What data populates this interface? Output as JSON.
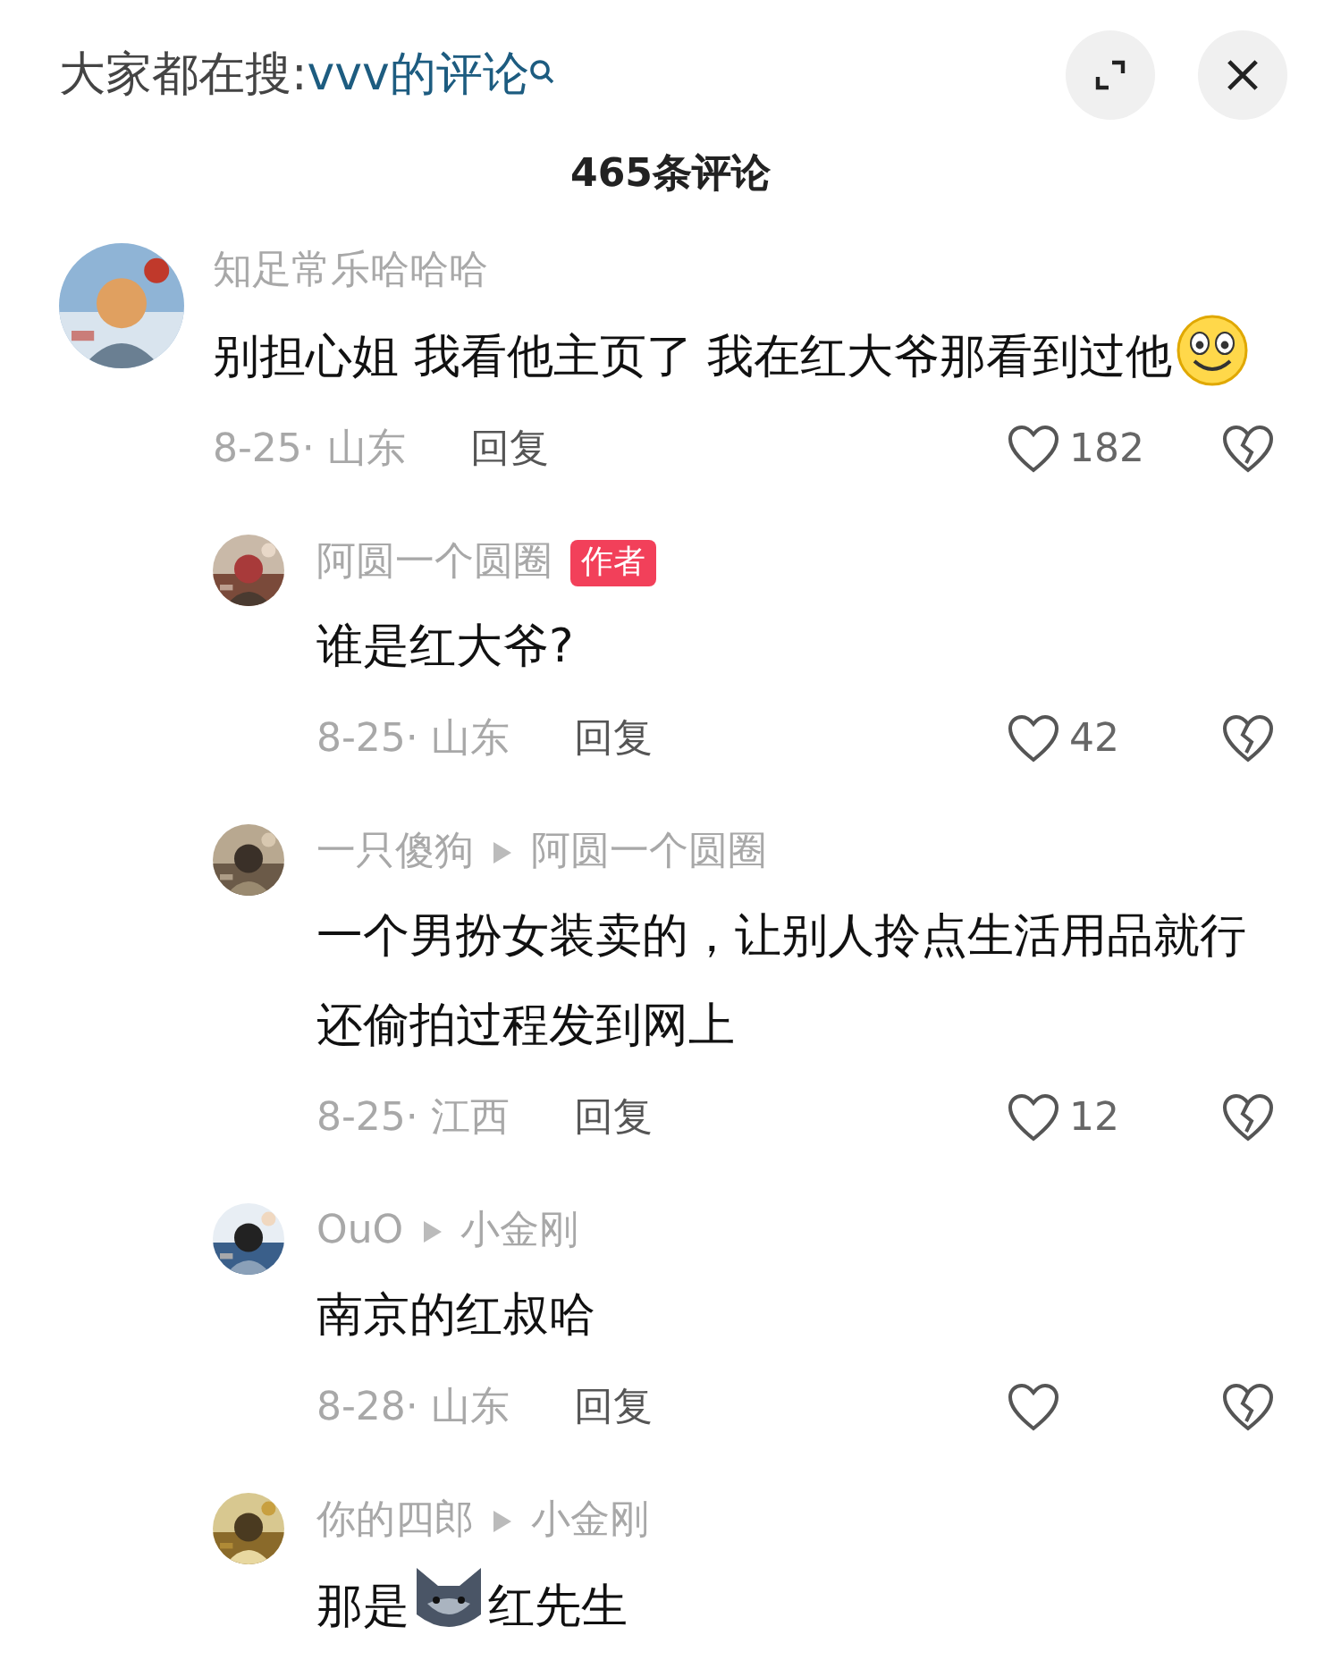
{
  "search": {
    "prefix": "大家都在搜:",
    "query": "vvv的评论"
  },
  "count": "465条评论",
  "comments": [
    {
      "user": "知足常乐哈哈哈",
      "content": [
        {
          "kind": "text",
          "text": "别担心姐 我看他主页了 我在红大爷那看到过他"
        },
        {
          "kind": "smiley"
        }
      ],
      "date_location": "8-25· 山东",
      "reply_label": "回复",
      "likes": "182",
      "liked": false,
      "children": [
        {
          "user": "阿圆一个圆圈",
          "author_badge": "作者",
          "content": [
            {
              "kind": "text",
              "text": "谁是红大爷?"
            }
          ],
          "date_location": "8-25· 山东",
          "reply_label": "回复",
          "likes": "42",
          "liked": false
        },
        {
          "user": "一只傻狗",
          "reply_to": "阿圆一个圆圈",
          "content": [
            {
              "kind": "text",
              "text": "一个男扮女装卖的，让别人拎点生活用品就行还偷拍过程发到网上"
            }
          ],
          "date_location": "8-25· 江西",
          "reply_label": "回复",
          "likes": "12",
          "liked": false
        },
        {
          "user": "OuO",
          "reply_to": "小金刚",
          "content": [
            {
              "kind": "text",
              "text": "南京的红叔哈"
            }
          ],
          "date_location": "8-28· 山东",
          "reply_label": "回复",
          "liked": false
        },
        {
          "user": "你的四郎",
          "reply_to": "小金刚",
          "content": [
            {
              "kind": "text",
              "text": "那是"
            },
            {
              "kind": "wolf"
            },
            {
              "kind": "text",
              "text": "红先生"
            }
          ]
        }
      ]
    }
  ]
}
